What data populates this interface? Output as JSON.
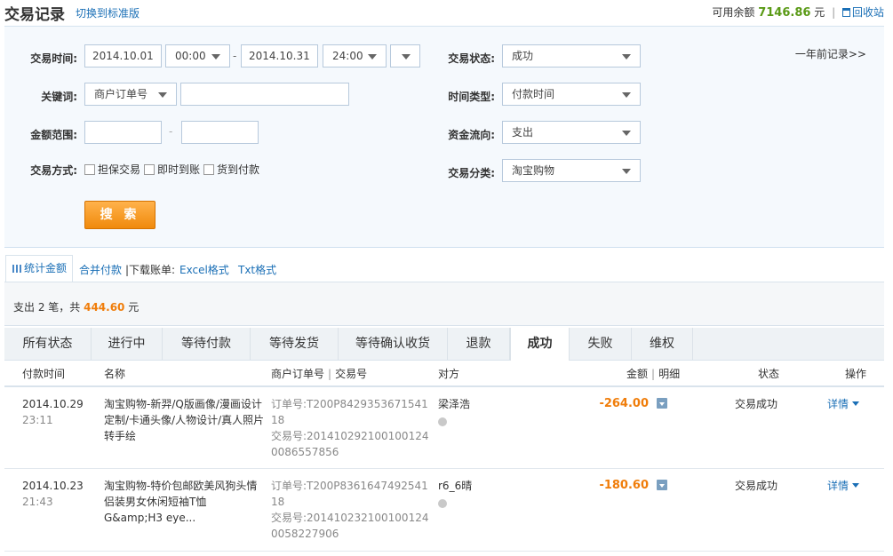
{
  "header": {
    "title": "交易记录",
    "switch_link": "切换到标准版",
    "balance_label": "可用余额",
    "balance_value": "7146.86",
    "balance_unit": "元",
    "recycle_link": "回收站"
  },
  "filter": {
    "trade_time_label": "交易时间:",
    "start_date": "2014.10.01",
    "start_time": "00:00",
    "end_date": "2014.10.31",
    "end_time": "24:00",
    "keyword_label": "关键词:",
    "keyword_type": "商户订单号",
    "keyword_value": "",
    "amount_label": "金额范围:",
    "amount_min": "",
    "amount_max": "",
    "trade_method_label": "交易方式:",
    "methods": [
      "担保交易",
      "即时到账",
      "货到付款"
    ],
    "status_label": "交易状态:",
    "status_value": "成功",
    "time_type_label": "时间类型:",
    "time_type_value": "付款时间",
    "flow_label": "资金流向:",
    "flow_value": "支出",
    "category_label": "交易分类:",
    "category_value": "淘宝购物",
    "older_link": "一年前记录>>",
    "search_button": "搜 索"
  },
  "tools": {
    "stat_tab": "统计金额",
    "merge_pay": "合并付款",
    "download_label": "|下载账单:",
    "excel": "Excel格式",
    "txt": "Txt格式"
  },
  "summary": {
    "prefix": "支出 2 笔，共",
    "amount": "444.60",
    "suffix": "元"
  },
  "status_tabs": [
    "所有状态",
    "进行中",
    "等待付款",
    "等待发货",
    "等待确认收货",
    "退款",
    "成功",
    "失败",
    "维权"
  ],
  "active_tab": "成功",
  "columns": {
    "pay_time": "付款时间",
    "name": "名称",
    "merchant_order": "商户订单号",
    "trade_no": "交易号",
    "counterparty": "对方",
    "amount": "金额",
    "detail": "明细",
    "status": "状态",
    "action": "操作"
  },
  "rows": [
    {
      "date": "2014.10.29",
      "time": "23:11",
      "name": "淘宝购物-新羿/Q版画像/漫画设计定制/卡通头像/人物设计/真人照片转手绘",
      "order_no": "订单号:T200P842935367154118",
      "trade_no": "交易号:2014102921001001240086557856",
      "party": "梁泽浩",
      "amount": "-264.00",
      "status": "交易成功",
      "action": "详情"
    },
    {
      "date": "2014.10.23",
      "time": "21:43",
      "name": "淘宝购物-特价包邮欧美风狗头情侣装男女休闲短袖T恤 G&amp;H3 eye...",
      "order_no": "订单号:T200P836164749254118",
      "trade_no": "交易号:2014102321001001240058227906",
      "party": "r6_6晴",
      "amount": "-180.60",
      "status": "交易成功",
      "action": "详情"
    }
  ]
}
